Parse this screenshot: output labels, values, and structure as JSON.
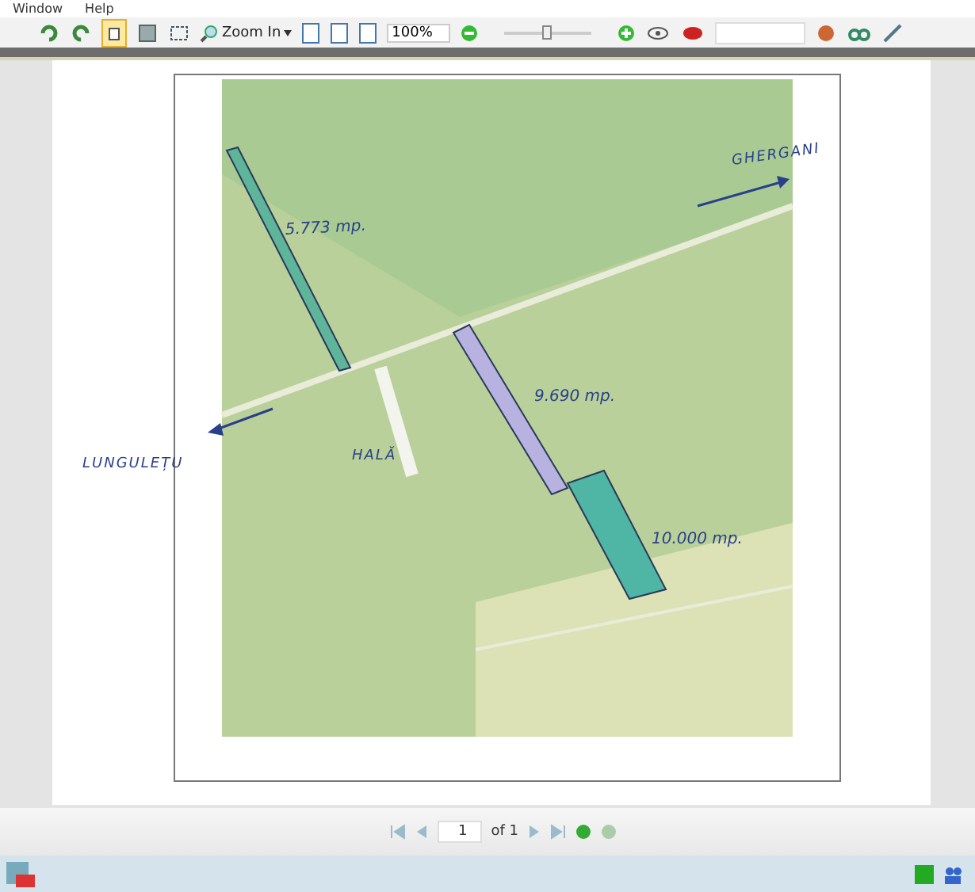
{
  "menu": [
    {
      "label": "Window"
    },
    {
      "label": "Help"
    }
  ],
  "toolbar": {
    "zoom_button": "Zoom In",
    "zoom_value": "100%",
    "zoom_slider": {
      "level": 0.5
    }
  },
  "document": {
    "labels": [
      {
        "kind": "area",
        "text": "5.773 mp."
      },
      {
        "kind": "place",
        "text": "GHERGANI"
      },
      {
        "kind": "area",
        "text": "9.690 mp."
      },
      {
        "kind": "place",
        "text": "HALĂ"
      },
      {
        "kind": "place",
        "text": "LUNGULEȚU"
      },
      {
        "kind": "area",
        "text": "10.000 mp."
      }
    ]
  },
  "navigation": {
    "page": "1",
    "page_count": "of 1"
  }
}
